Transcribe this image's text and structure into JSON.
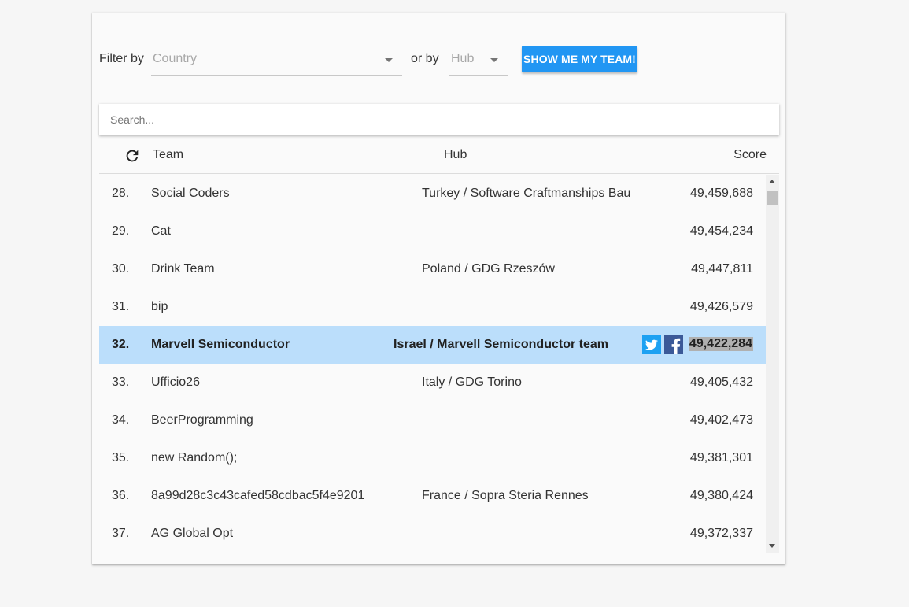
{
  "filters": {
    "filter_by_label": "Filter by",
    "country_placeholder": "Country",
    "or_by_label": "or by",
    "hub_placeholder": "Hub",
    "show_team_label": "SHOW ME MY TEAM!"
  },
  "search": {
    "placeholder": "Search..."
  },
  "table": {
    "headers": {
      "team": "Team",
      "hub": "Hub",
      "score": "Score"
    },
    "rows": [
      {
        "rank": "28.",
        "team": "Social Coders",
        "hub": "Turkey / Software Craftmanships Bau",
        "score": "49,459,688"
      },
      {
        "rank": "29.",
        "team": "Cat",
        "hub": "",
        "score": "49,454,234"
      },
      {
        "rank": "30.",
        "team": "Drink Team",
        "hub": "Poland / GDG Rzeszów",
        "score": "49,447,811"
      },
      {
        "rank": "31.",
        "team": "bip",
        "hub": "",
        "score": "49,426,579"
      },
      {
        "rank": "32.",
        "team": "Marvell Semiconductor",
        "hub": "Israel / Marvell Semiconductor team",
        "score": "49,422,284",
        "highlighted": true
      },
      {
        "rank": "33.",
        "team": "Ufficio26",
        "hub": "Italy / GDG Torino",
        "score": "49,405,432"
      },
      {
        "rank": "34.",
        "team": "BeerProgramming",
        "hub": "",
        "score": "49,402,473"
      },
      {
        "rank": "35.",
        "team": "new Random();",
        "hub": "",
        "score": "49,381,301"
      },
      {
        "rank": "36.",
        "team": "8a99d28c3c43cafed58cdbac5f4e9201",
        "hub": "France / Sopra Steria Rennes",
        "score": "49,380,424"
      },
      {
        "rank": "37.",
        "team": "AG Global Opt",
        "hub": "",
        "score": "49,372,337"
      }
    ]
  },
  "colors": {
    "accent": "#2196f3",
    "highlight_row": "#bbdefb",
    "twitter": "#1da1f2",
    "facebook": "#3b5998"
  },
  "icons": {
    "refresh": "refresh-icon",
    "twitter": "twitter-icon",
    "facebook": "facebook-icon",
    "dropdown": "caret-down-icon"
  }
}
